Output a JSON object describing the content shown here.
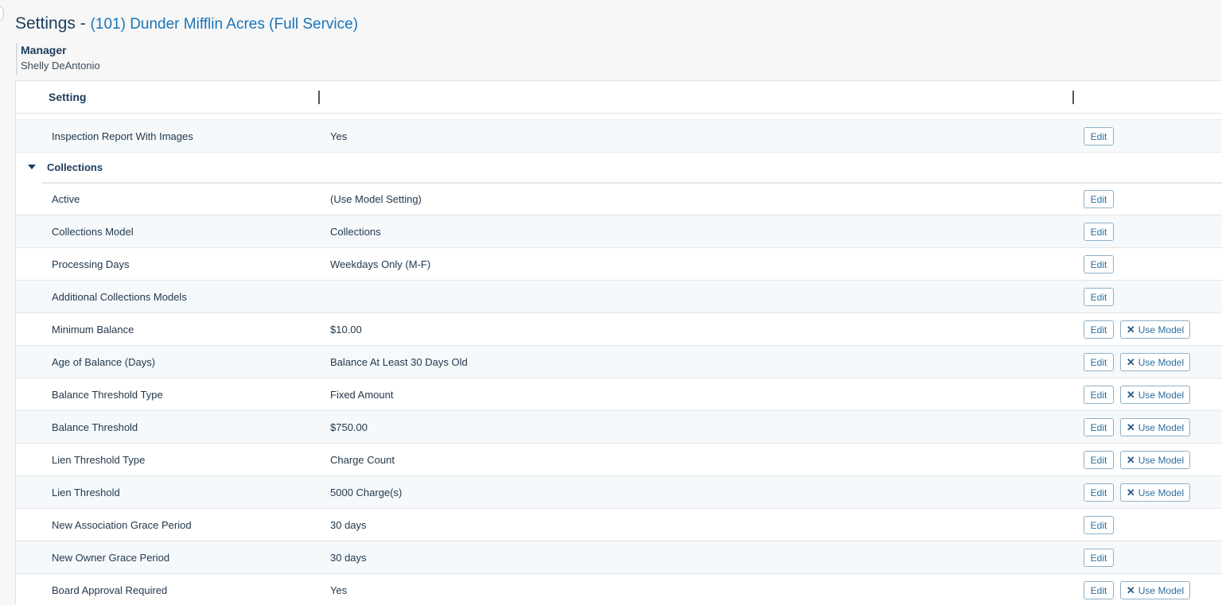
{
  "header": {
    "title_prefix": "Settings -",
    "org_name": "(101) Dunder Mifflin Acres (Full Service)"
  },
  "manager": {
    "label": "Manager",
    "name": "Shelly DeAntonio"
  },
  "grid": {
    "columns": [
      "Setting",
      "",
      ""
    ],
    "buttons": {
      "edit": "Edit",
      "use_model": "Use Model"
    },
    "top_row": {
      "name": "Inspection Report With Images",
      "value": "Yes"
    },
    "group": {
      "label": "Collections",
      "rows": [
        {
          "name": "Active",
          "value": "(Use Model Setting)",
          "use_model": false
        },
        {
          "name": "Collections Model",
          "value": "Collections",
          "use_model": false
        },
        {
          "name": "Processing Days",
          "value": "Weekdays Only (M-F)",
          "use_model": false
        },
        {
          "name": "Additional Collections Models",
          "value": "",
          "use_model": false
        },
        {
          "name": "Minimum Balance",
          "value": "$10.00",
          "use_model": true
        },
        {
          "name": "Age of Balance (Days)",
          "value": "Balance At Least 30 Days Old",
          "use_model": true
        },
        {
          "name": "Balance Threshold Type",
          "value": "Fixed Amount",
          "use_model": true
        },
        {
          "name": "Balance Threshold",
          "value": "$750.00",
          "use_model": true
        },
        {
          "name": "Lien Threshold Type",
          "value": "Charge Count",
          "use_model": true
        },
        {
          "name": "Lien Threshold",
          "value": "5000 Charge(s)",
          "use_model": true
        },
        {
          "name": "New Association Grace Period",
          "value": "30 days",
          "use_model": false
        },
        {
          "name": "New Owner Grace Period",
          "value": "30 days",
          "use_model": false
        },
        {
          "name": "Board Approval Required",
          "value": "Yes",
          "use_model": true
        }
      ]
    }
  }
}
